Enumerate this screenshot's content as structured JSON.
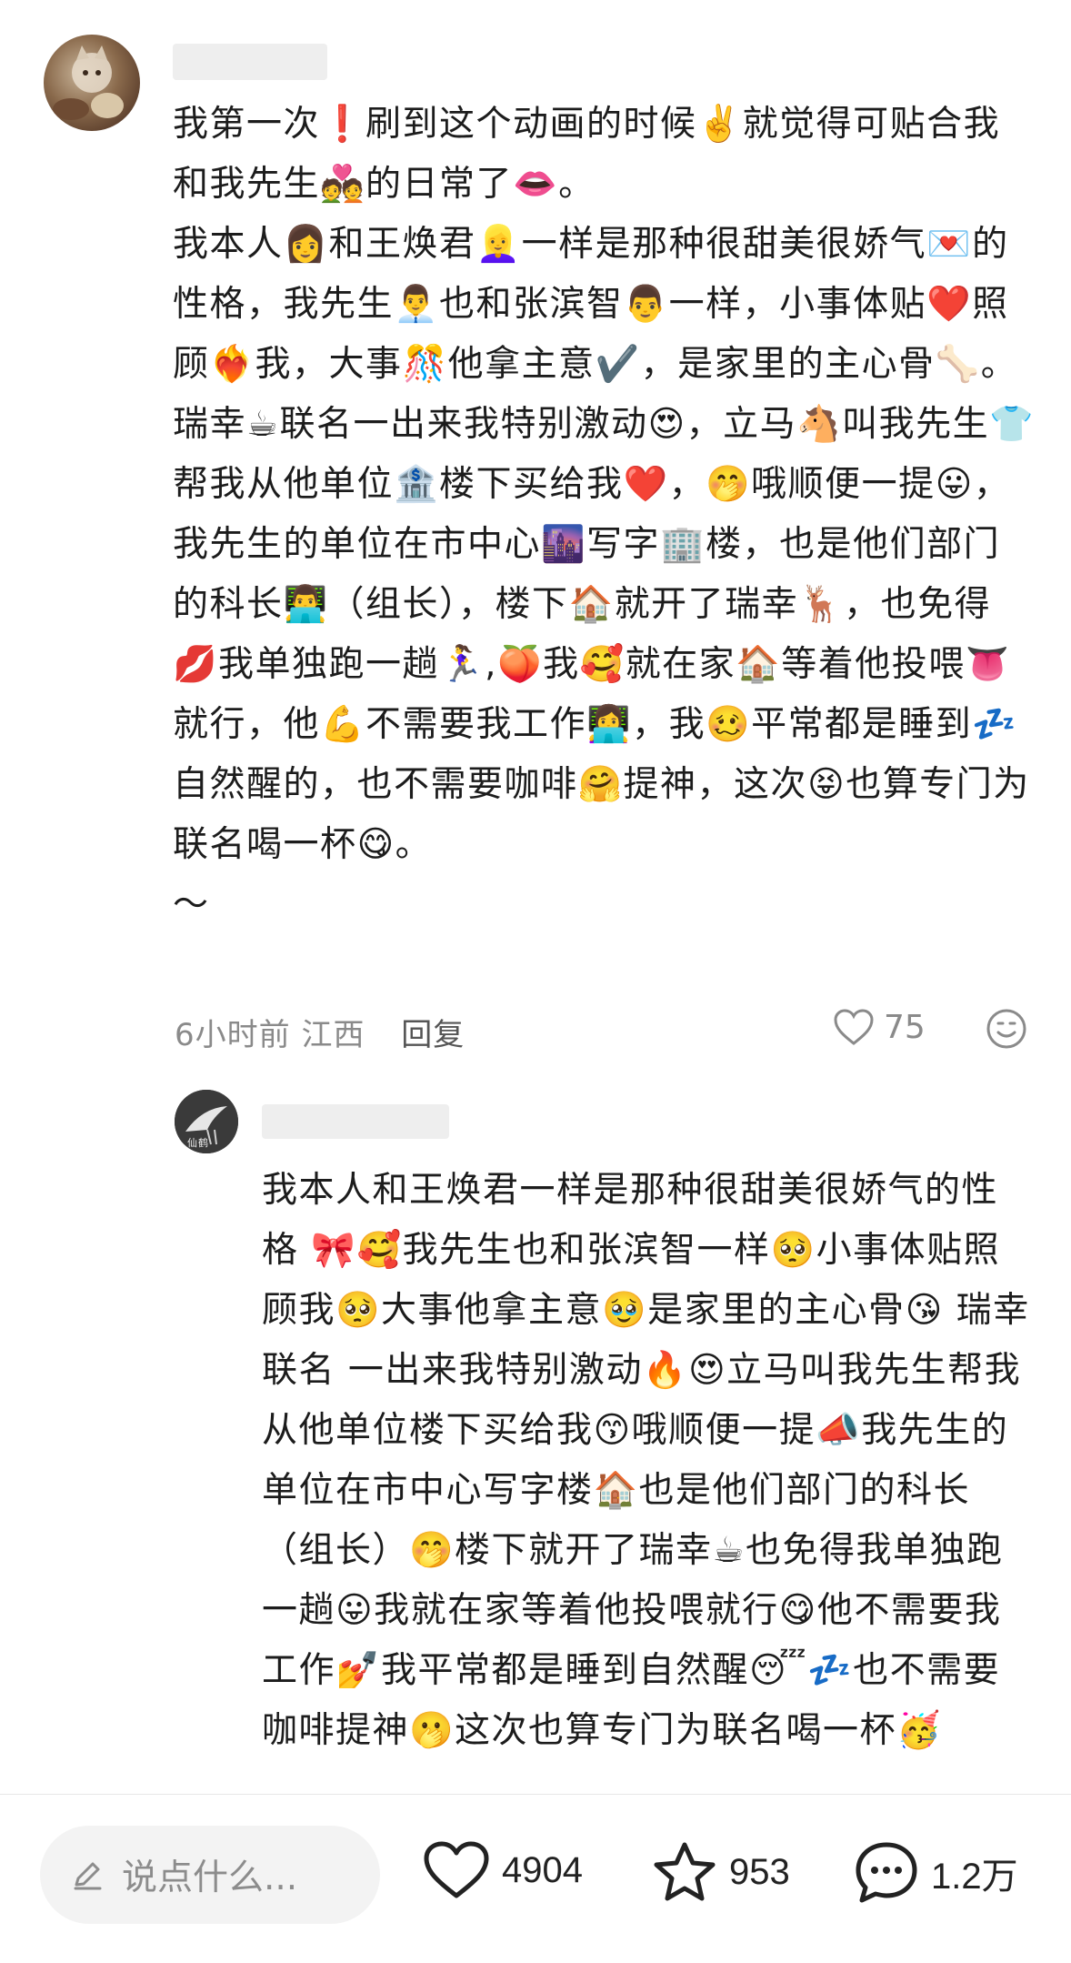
{
  "main_comment": {
    "paragraphs": [
      "我第一次❗刷到这个动画的时候✌️就觉得可贴合我和我先生💑的日常了👄。",
      "我本人👩和王焕君👱‍♀️一样是那种很甜美很娇气💌的性格，我先生👨‍💼也和张滨智👨一样，小事体贴❤️照顾❤️‍🔥我，大事🎊他拿主意✔️，是家里的主心骨🦴。",
      "瑞幸☕联名一出来我特别激动😍，立马🐴叫我先生👕帮我从他单位🏦楼下买给我❤️，🤭哦顺便一提😛，我先生的单位在市中心🌆写字🏢楼，也是他们部门的科长👨‍💻（组长），楼下🏠就开了瑞幸🦌，也免得💋我单独跑一趟🏃‍♀️,🍑我🥰就在家🏠等着他投喂👅就行，他💪不需要我工作👩‍💻，我🥴平常都是睡到💤自然醒的，也不需要咖啡🤗提神，这次😝也算专门为联名喝一杯😋。",
      "～"
    ],
    "time": "6小时前",
    "location": "江西",
    "reply_label": "回复",
    "likes": "75"
  },
  "reply_comment": {
    "avatar_caption": "仙鹤",
    "paragraphs": [
      "我本人和王焕君一样是那种很甜美很娇气的性格 🎀🥰我先生也和张滨智一样🥺小事体贴照顾我🥺大事他拿主意🥹是家里的主心骨😘 瑞幸联名 一出来我特别激动🔥😍立马叫我先生帮我从他单位楼下买给我😙哦顺便一提📣我先生的单位在市中心写字楼🏠也是他们部门的科长（组长）🤭楼下就开了瑞幸☕也免得我单独跑一趟😛我就在家等着他投喂就行😋他不需要我工作💅我平常都是睡到自然醒😴💤也不需要咖啡提神🫢这次也算专门为联名喝一杯🥳"
    ]
  },
  "bottom_bar": {
    "input_placeholder": "说点什么...",
    "like_count": "4904",
    "star_count": "953",
    "comment_count": "1.2万"
  },
  "colors": {
    "text": "#1c1c1c",
    "meta": "#8a8a8a",
    "input_bg": "#f3f3f3"
  }
}
